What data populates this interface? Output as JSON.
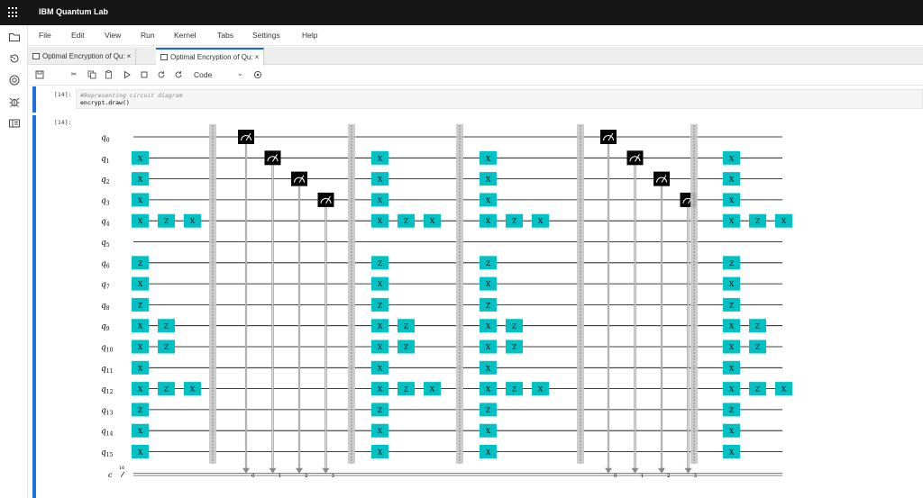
{
  "app": {
    "title": "IBM Quantum Lab"
  },
  "menu": [
    "File",
    "Edit",
    "View",
    "Run",
    "Kernel",
    "Tabs",
    "Settings",
    "Help"
  ],
  "tabs": [
    {
      "label": "Optimal Encryption of Qu:",
      "close": "×"
    },
    {
      "label": "Optimal Encryption of Qu:",
      "close": "×"
    }
  ],
  "toolbar": {
    "cell_type": "Code"
  },
  "cells": {
    "input": {
      "prompt": "[14]:",
      "comment": "#Representing circuit diagram",
      "code": "encrypt.draw()"
    },
    "output": {
      "prompt": "[14]:"
    }
  },
  "colors": {
    "accent": "#1f6feb",
    "gate": "#00c1c3",
    "topbar": "#161616"
  },
  "circuit": {
    "qubits": [
      "q0",
      "q1",
      "q2",
      "q3",
      "q4",
      "q5",
      "q6",
      "q7",
      "q8",
      "q9",
      "q10",
      "q11",
      "q12",
      "q13",
      "q14",
      "q15"
    ],
    "classical": "c",
    "classical_size": "16",
    "blocks": [
      {
        "type": "gates",
        "columns": [
          [
            "",
            "X",
            "X",
            "X",
            "X",
            "",
            "Z",
            "X",
            "Z",
            "X",
            "X",
            "X",
            "X",
            "Z",
            "X",
            "X"
          ],
          [
            "",
            "",
            "",
            "",
            "Z",
            "",
            "",
            "",
            "",
            "Z",
            "Z",
            "",
            "Z",
            "",
            "",
            ""
          ],
          [
            "",
            "",
            "",
            "",
            "X",
            "",
            "",
            "",
            "",
            "",
            "",
            "",
            "X",
            "",
            "",
            ""
          ]
        ]
      },
      {
        "type": "barrier"
      },
      {
        "type": "measure",
        "qubits": [
          0,
          1,
          2,
          3
        ],
        "bits": [
          "0",
          "1",
          "2",
          "3"
        ]
      },
      {
        "type": "barrier"
      },
      {
        "type": "gates",
        "columns": [
          [
            "",
            "X",
            "X",
            "X",
            "X",
            "",
            "Z",
            "X",
            "Z",
            "X",
            "X",
            "X",
            "X",
            "Z",
            "X",
            "X"
          ],
          [
            "",
            "",
            "",
            "",
            "Z",
            "",
            "",
            "",
            "",
            "Z",
            "Z",
            "",
            "Z",
            "",
            "",
            ""
          ],
          [
            "",
            "",
            "",
            "",
            "X",
            "",
            "",
            "",
            "",
            "",
            "",
            "",
            "X",
            "",
            "",
            ""
          ]
        ]
      },
      {
        "type": "barrier"
      },
      {
        "type": "gates",
        "columns": [
          [
            "",
            "X",
            "X",
            "X",
            "X",
            "",
            "Z",
            "X",
            "Z",
            "X",
            "X",
            "X",
            "X",
            "Z",
            "X",
            "X"
          ],
          [
            "",
            "",
            "",
            "",
            "Z",
            "",
            "",
            "",
            "",
            "Z",
            "Z",
            "",
            "Z",
            "",
            "",
            ""
          ],
          [
            "",
            "",
            "",
            "",
            "X",
            "",
            "",
            "",
            "",
            "",
            "",
            "",
            "X",
            "",
            "",
            ""
          ]
        ]
      },
      {
        "type": "barrier"
      },
      {
        "type": "measure",
        "qubits": [
          0,
          1,
          2,
          3
        ],
        "bits": [
          "0",
          "1",
          "2",
          "3"
        ]
      },
      {
        "type": "barrier"
      },
      {
        "type": "gates",
        "columns": [
          [
            "",
            "X",
            "X",
            "X",
            "X",
            "",
            "Z",
            "X",
            "Z",
            "X",
            "X",
            "X",
            "X",
            "Z",
            "X",
            "X"
          ],
          [
            "",
            "",
            "",
            "",
            "Z",
            "",
            "",
            "",
            "",
            "Z",
            "Z",
            "",
            "Z",
            "",
            "",
            ""
          ],
          [
            "",
            "",
            "",
            "",
            "X",
            "",
            "",
            "",
            "",
            "",
            "",
            "",
            "X",
            "",
            "",
            ""
          ]
        ]
      }
    ]
  }
}
